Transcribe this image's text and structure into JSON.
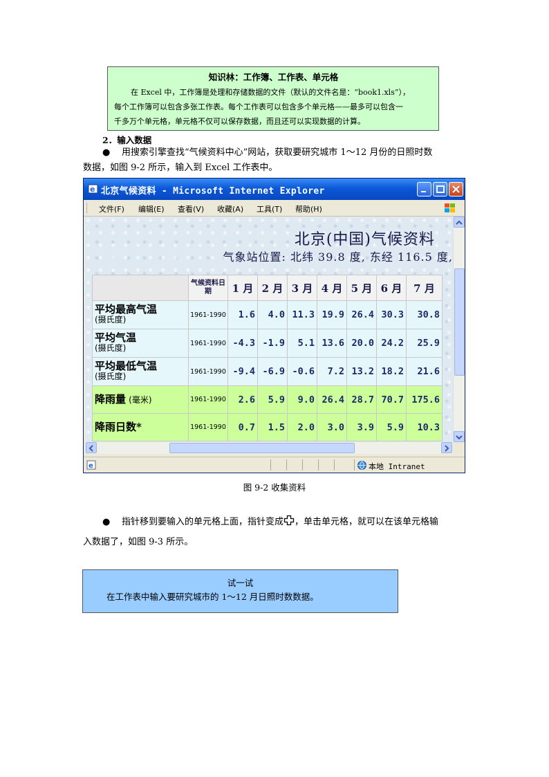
{
  "knowledge_box": {
    "title": "知识林：工作簿、工作表、单元格",
    "line1": "在 Excel 中，工作簿是处理和存储数据的文件（默认的文件名是：“book1.xls”），",
    "line2": "每个工作簿可以包含多张工作表。每个工作表可以包含多个单元格——最多可以包含一",
    "line3": "千多万个单元格，单元格不仅可以保存数据，而且还可以实现数据的计算。"
  },
  "section": {
    "title": "2．输入数据",
    "bullet_glyph": "●",
    "para1_line1": "用搜索引擎查找“气候资料中心”网站，获取要研究城市 1～12 月份的日照时数",
    "para1_line2": "数据，如图 9-2 所示，输入到 Excel 工作表中。"
  },
  "browser": {
    "window_title": "北京气候资料 - Microsoft Internet Explorer",
    "menu": [
      "文件(F)",
      "编辑(E)",
      "查看(V)",
      "收藏(A)",
      "工具(T)",
      "帮助(H)"
    ],
    "page_heading": "北京(中国)气候资料",
    "station": "气象站位置:  北纬 39.8 度,  东经 116.5 度,",
    "status_zone": "本地 Intranet",
    "table": {
      "date_header": "气候资料日期",
      "months": [
        "1 月",
        "2 月",
        "3 月",
        "4 月",
        "5 月",
        "6 月",
        "7 月"
      ],
      "rows": [
        {
          "label": "平均最高气温",
          "unit": "(摄氏度)",
          "date": "1961-1990",
          "values": [
            "1.6",
            "4.0",
            "11.3",
            "19.9",
            "26.4",
            "30.3",
            "30.8"
          ]
        },
        {
          "label": "平均气温",
          "unit": "(摄氏度)",
          "date": "1961-1990",
          "values": [
            "-4.3",
            "-1.9",
            "5.1",
            "13.6",
            "20.0",
            "24.2",
            "25.9"
          ]
        },
        {
          "label": "平均最低气温",
          "unit": "(摄氏度)",
          "date": "1961-1990",
          "values": [
            "-9.4",
            "-6.9",
            "-0.6",
            "7.2",
            "13.2",
            "18.2",
            "21.6"
          ]
        },
        {
          "label": "降雨量",
          "unit": "(毫米)",
          "date": "1961-1990",
          "values": [
            "2.6",
            "5.9",
            "9.0",
            "26.4",
            "28.7",
            "70.7",
            "175.6"
          ]
        },
        {
          "label": "降雨日数*",
          "unit": "",
          "date": "1961-1990",
          "values": [
            "0.7",
            "1.5",
            "2.0",
            "3.0",
            "3.9",
            "5.9",
            "10.3"
          ]
        }
      ]
    }
  },
  "figure_caption": "图 9-2  收集资料",
  "para2": {
    "bullet_glyph": "●",
    "before_icon": "指针移到要输入的单元格上面，指针变成",
    "after_icon": "，单击单元格，就可以在该单元格输",
    "line2": "入数据了，如图 9-3 所示。"
  },
  "try_box": {
    "title": "试一试",
    "body": "在工作表中输入要研究城市的 1～12 月日照时数数据。"
  }
}
